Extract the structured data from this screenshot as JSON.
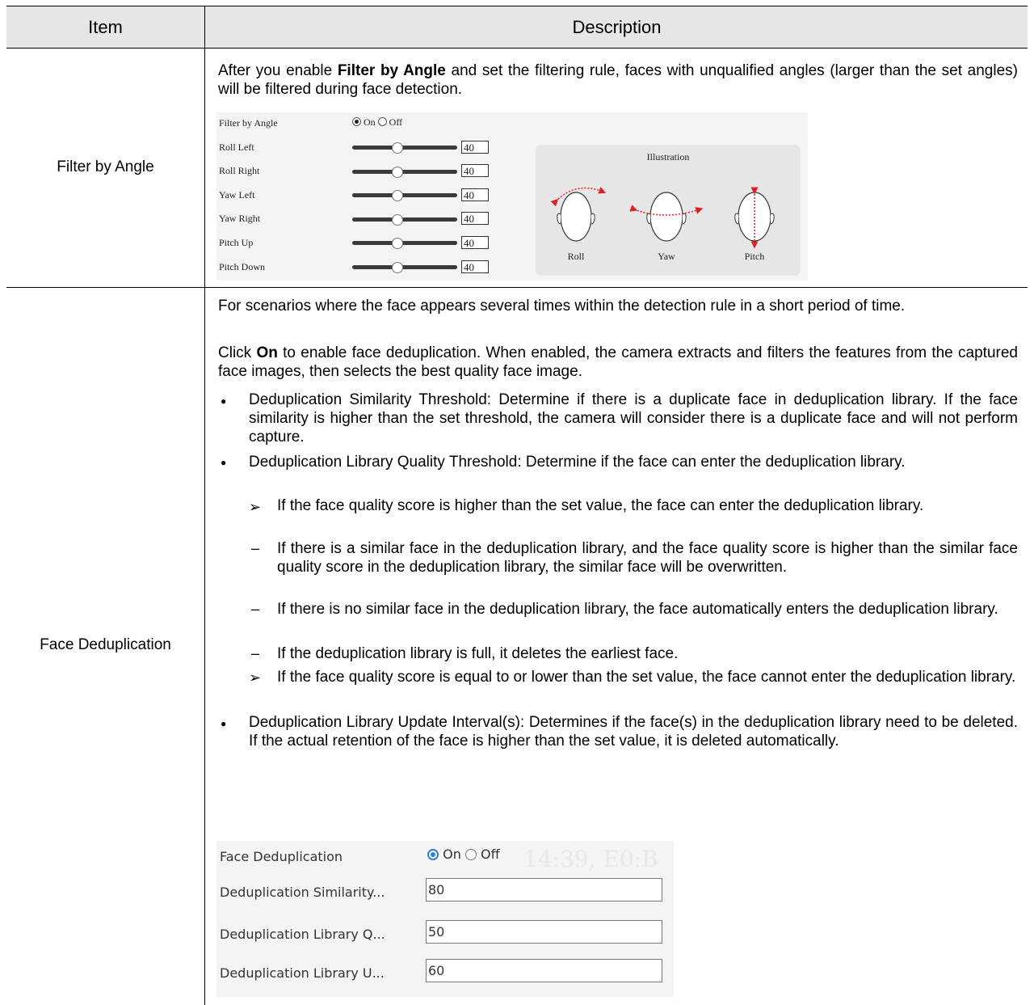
{
  "table": {
    "headers": {
      "item": "Item",
      "description": "Description"
    }
  },
  "rows": {
    "angle": {
      "item": "Filter by Angle",
      "desc_pre": "After you enable ",
      "desc_bold": "Filter by Angle",
      "desc_post": " and set the filtering rule, faces with unqualified angles (larger than the set angles) will be filtered during face detection."
    },
    "dedup": {
      "item": "Face Deduplication",
      "p1": "For scenarios where the face appears several times within the detection rule in a short period of time.",
      "p2_pre": "Click ",
      "p2_bold": "On",
      "p2_post": " to enable face deduplication. When enabled, the camera extracts and filters the features from the captured face images, then selects the best quality face image.",
      "b1": "Deduplication Similarity Threshold: Determine if there is a duplicate face in deduplication library. If the face similarity is higher than the set threshold, the camera will consider there is a duplicate face and will not perform capture.",
      "b2": "Deduplication Library Quality Threshold: Determine if the face can enter the deduplication library.",
      "b2a": "If the face quality score is higher than the set value, the face can enter the deduplication library.",
      "b2a1": "If there is a similar face in the deduplication library, and the face quality score is higher than the similar face quality score in the deduplication library, the similar face will be overwritten.",
      "b2a2": "If there is no similar face in the deduplication library, the face automatically enters the deduplication library.",
      "b2a3": "If the deduplication library is full, it deletes the earliest face.",
      "b2b": "If the face quality score is equal to or lower than the set value, the face cannot enter the deduplication library.",
      "b3": "Deduplication Library Update Interval(s): Determines if the face(s) in the deduplication library need to be deleted. If the actual retention of the face is higher than the set value, it is deleted automatically."
    }
  },
  "angle_ui": {
    "filter_label": "Filter by Angle",
    "on_label": "On",
    "off_label": "Off",
    "filter_on": true,
    "sliders": [
      {
        "label": "Roll Left",
        "value": "40"
      },
      {
        "label": "Roll Right",
        "value": "40"
      },
      {
        "label": "Yaw Left",
        "value": "40"
      },
      {
        "label": "Yaw Right",
        "value": "40"
      },
      {
        "label": "Pitch Up",
        "value": "40"
      },
      {
        "label": "Pitch Down",
        "value": "40"
      }
    ],
    "illustration": {
      "title": "Illustration",
      "captions": [
        "Roll",
        "Yaw",
        "Pitch"
      ]
    },
    "arrow_color": "#e02020"
  },
  "dedup_ui": {
    "label": "Face Deduplication",
    "on_label": "On",
    "off_label": "Off",
    "enabled": true,
    "bg_text": "14:39, E0:B",
    "fields": [
      {
        "label": "Deduplication Similarity...",
        "value": "80"
      },
      {
        "label": "Deduplication Library Q...",
        "value": "50"
      },
      {
        "label": "Deduplication Library U...",
        "value": "60"
      }
    ],
    "accent_color": "#2f7fd6"
  }
}
